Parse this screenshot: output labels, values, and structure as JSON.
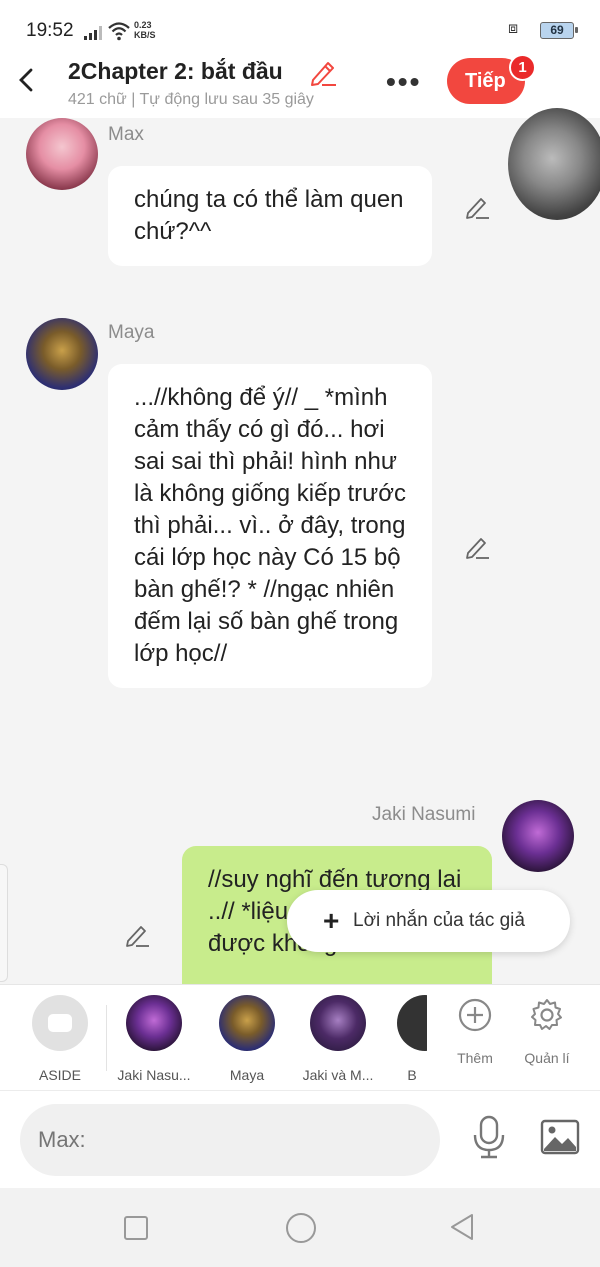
{
  "status_bar": {
    "time": "19:52",
    "net_speed_value": "0.23",
    "net_speed_unit": "KB/S",
    "battery": "69"
  },
  "header": {
    "title": "2Chapter 2: bắt đầu",
    "subtitle": "421 chữ | Tự động lưu sau 35 giây",
    "next_label": "Tiếp",
    "notification_count": "1"
  },
  "messages": [
    {
      "speaker": "Max",
      "text": "chúng ta có thể làm quen chứ?^^"
    },
    {
      "speaker": "Maya",
      "text": "...//không để ý// _ *mình cảm thấy có gì đó... hơi sai sai thì phải! hình như là không giống kiếp trước thì phải... vì.. ở đây, trong cái lớp học này Có 15 bộ bàn ghế!? * //ngạc nhiên đếm lại số bàn ghế trong lớp học//"
    },
    {
      "speaker": "Jaki Nasumi",
      "text": "//suy nghĩ đến tương lai ..// *liệu có quay về được không..? //trầm"
    }
  ],
  "author_note_label": "Lời nhắn của tác giả",
  "characters": [
    {
      "label": "ASIDE"
    },
    {
      "label": "Jaki Nasu..."
    },
    {
      "label": "Maya"
    },
    {
      "label": "Jaki và M..."
    },
    {
      "label": "B"
    }
  ],
  "tools": [
    {
      "label": "Thêm",
      "icon": "plus-circle-icon"
    },
    {
      "label": "Quản lí",
      "icon": "gear-icon"
    }
  ],
  "input": {
    "placeholder": "Max:"
  },
  "colors": {
    "accent": "#f2473f",
    "bubble_self": "#c8ec8c",
    "bubble_other": "#ffffff"
  }
}
